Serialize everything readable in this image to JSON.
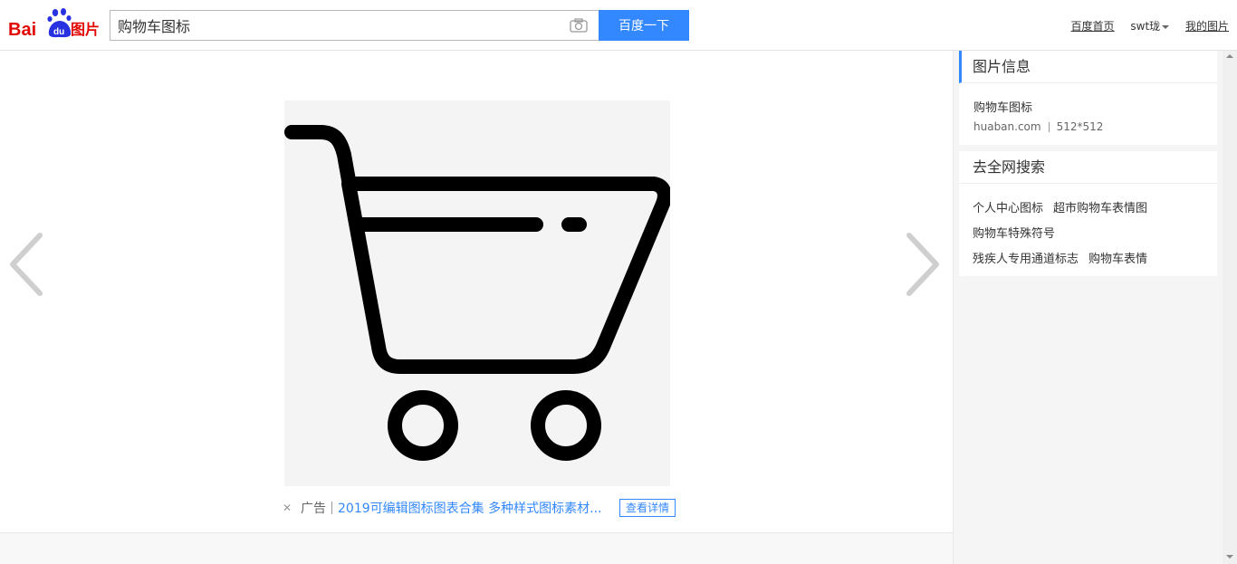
{
  "header": {
    "logo_text": "Bai du 图片",
    "search_value": "购物车图标",
    "search_button": "百度一下",
    "links": {
      "home": "百度首页",
      "user": "swt珑",
      "my_images": "我的图片"
    }
  },
  "ad": {
    "tag": "广告",
    "text": "2019可编辑图标图表合集 多种样式图标素材...",
    "button": "查看详情"
  },
  "sidebar": {
    "info_heading": "图片信息",
    "image_title": "购物车图标",
    "source": "huaban.com",
    "size": "512*512",
    "search_heading": "去全网搜索",
    "tags": [
      "个人中心图标",
      "超市购物车表情图",
      "购物车特殊符号",
      "残疾人专用通道标志",
      "购物车表情"
    ]
  },
  "icons": {
    "camera": "camera-icon",
    "prev": "chevron-left-icon",
    "next": "chevron-right-icon",
    "close": "close-icon"
  },
  "colors": {
    "accent": "#3388ff",
    "logo_red": "#e10602",
    "logo_blue": "#2932e1"
  }
}
